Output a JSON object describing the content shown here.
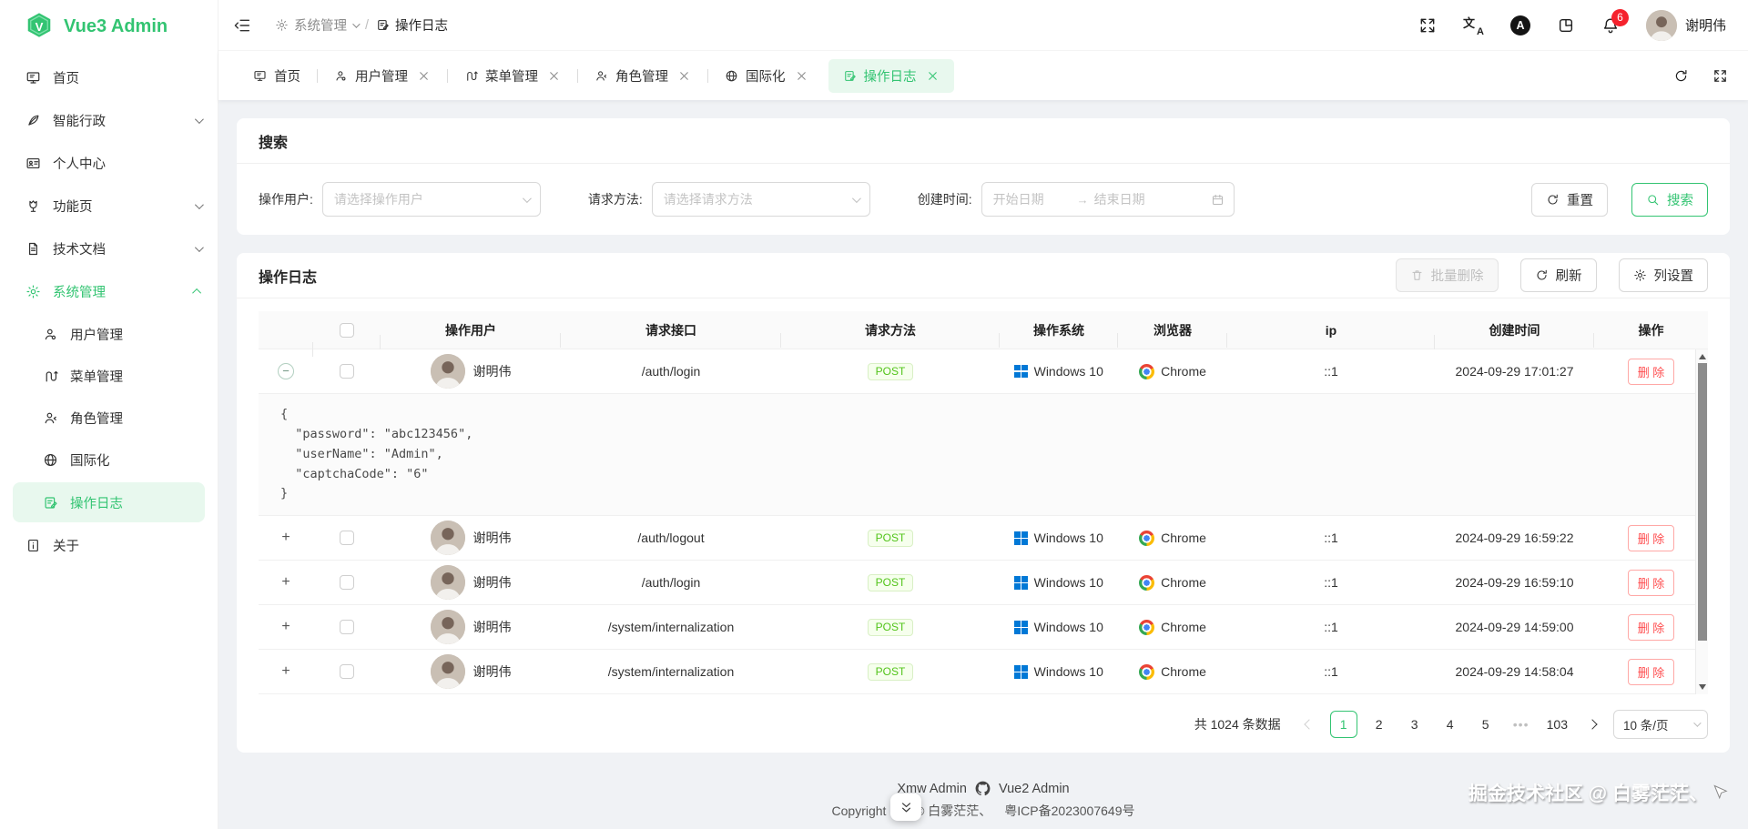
{
  "app": {
    "title": "Vue3 Admin"
  },
  "colors": {
    "primary": "#33c472",
    "primary_light_bg": "#e8f8ee",
    "success_text": "#52c41a",
    "success_bg": "#f6ffed",
    "danger": "#ff4d4f",
    "badge_red": "#f5222d",
    "windows_blue": "#0078d6",
    "content_bg": "#f0f2f5"
  },
  "sidebar": {
    "items": [
      {
        "label": "首页",
        "icon": "monitor-icon"
      },
      {
        "label": "智能行政",
        "icon": "quill-icon"
      },
      {
        "label": "个人中心",
        "icon": "id-card-icon"
      },
      {
        "label": "功能页",
        "icon": "flower-icon"
      },
      {
        "label": "技术文档",
        "icon": "document-icon"
      },
      {
        "label": "系统管理",
        "icon": "gear-icon",
        "children": [
          {
            "label": "用户管理",
            "icon": "user-manage-icon"
          },
          {
            "label": "菜单管理",
            "icon": "menu-route-icon"
          },
          {
            "label": "角色管理",
            "icon": "role-icon"
          },
          {
            "label": "国际化",
            "icon": "globe-icon"
          },
          {
            "label": "操作日志",
            "icon": "log-icon",
            "selected": true
          }
        ]
      },
      {
        "label": "关于",
        "icon": "about-icon"
      }
    ]
  },
  "topbar": {
    "breadcrumb": {
      "parent": "系统管理",
      "current": "操作日志"
    },
    "notification_count": "6",
    "user_name": "谢明伟"
  },
  "tabbar": {
    "tabs": [
      {
        "label": "首页"
      },
      {
        "label": "用户管理"
      },
      {
        "label": "菜单管理"
      },
      {
        "label": "角色管理"
      },
      {
        "label": "国际化"
      },
      {
        "label": "操作日志",
        "active": true
      }
    ]
  },
  "search": {
    "title": "搜索",
    "user_label": "操作用户:",
    "user_placeholder": "请选择操作用户",
    "method_label": "请求方法:",
    "method_placeholder": "请选择请求方法",
    "time_label": "创建时间:",
    "date_start_placeholder": "开始日期",
    "date_end_placeholder": "结束日期",
    "reset_label": "重置",
    "search_label": "搜索"
  },
  "log": {
    "title": "操作日志",
    "batch_delete_label": "批量删除",
    "refresh_label": "刷新",
    "column_settings_label": "列设置",
    "headers": {
      "user": "操作用户",
      "api": "请求接口",
      "method": "请求方法",
      "os": "操作系统",
      "browser": "浏览器",
      "ip": "ip",
      "created": "创建时间",
      "action": "操作"
    },
    "delete_label": "删 除",
    "rows": [
      {
        "user": "谢明伟",
        "api": "/auth/login",
        "method": "POST",
        "os": "Windows 10",
        "browser": "Chrome",
        "ip": "::1",
        "created": "2024-09-29 17:01:27"
      },
      {
        "user": "谢明伟",
        "api": "/auth/logout",
        "method": "POST",
        "os": "Windows 10",
        "browser": "Chrome",
        "ip": "::1",
        "created": "2024-09-29 16:59:22"
      },
      {
        "user": "谢明伟",
        "api": "/auth/login",
        "method": "POST",
        "os": "Windows 10",
        "browser": "Chrome",
        "ip": "::1",
        "created": "2024-09-29 16:59:10"
      },
      {
        "user": "谢明伟",
        "api": "/system/internalization",
        "method": "POST",
        "os": "Windows 10",
        "browser": "Chrome",
        "ip": "::1",
        "created": "2024-09-29 14:59:00"
      },
      {
        "user": "谢明伟",
        "api": "/system/internalization",
        "method": "POST",
        "os": "Windows 10",
        "browser": "Chrome",
        "ip": "::1",
        "created": "2024-09-29 14:58:04"
      }
    ],
    "expanded_row_json": "{\n  \"password\": \"abc123456\",\n  \"userName\": \"Admin\",\n  \"captchaCode\": \"6\"\n}",
    "pagination": {
      "total": "共 1024 条数据",
      "pages": [
        "1",
        "2",
        "3",
        "4",
        "5",
        "•••",
        "103"
      ],
      "active_page": "1",
      "page_size": "10 条/页"
    }
  },
  "footer": {
    "link_xmw": "Xmw Admin",
    "link_vue2": "Vue2 Admin",
    "copyright": "Copyright MIT © 白雾茫茫、",
    "icp": "粤ICP备2023007649号",
    "watermark": "掘金技术社区 @ 白雾茫茫、"
  }
}
